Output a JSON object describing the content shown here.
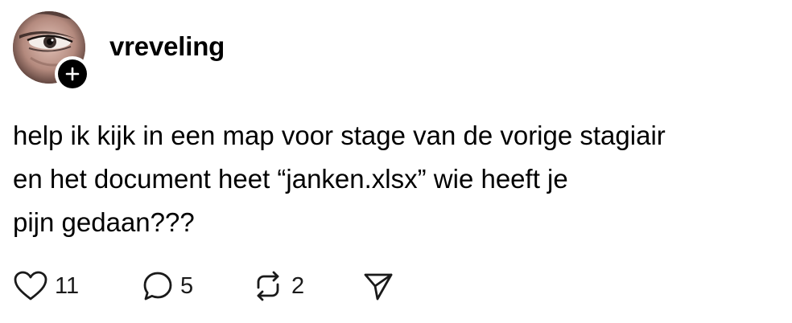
{
  "author": {
    "username": "vreveling",
    "follow_badge_icon": "plus-icon"
  },
  "post": {
    "text": "help ik kijk in een map voor stage van de vorige stagiair\nen het document heet “janken.xlsx” wie heeft je\npijn gedaan???"
  },
  "actions": {
    "like": {
      "icon": "heart-icon",
      "count": "11"
    },
    "reply": {
      "icon": "comment-icon",
      "count": "5"
    },
    "repost": {
      "icon": "repost-icon",
      "count": "2"
    },
    "share": {
      "icon": "send-icon"
    }
  },
  "colors": {
    "background": "#ffffff",
    "text": "#000000",
    "badge": "#000000"
  }
}
